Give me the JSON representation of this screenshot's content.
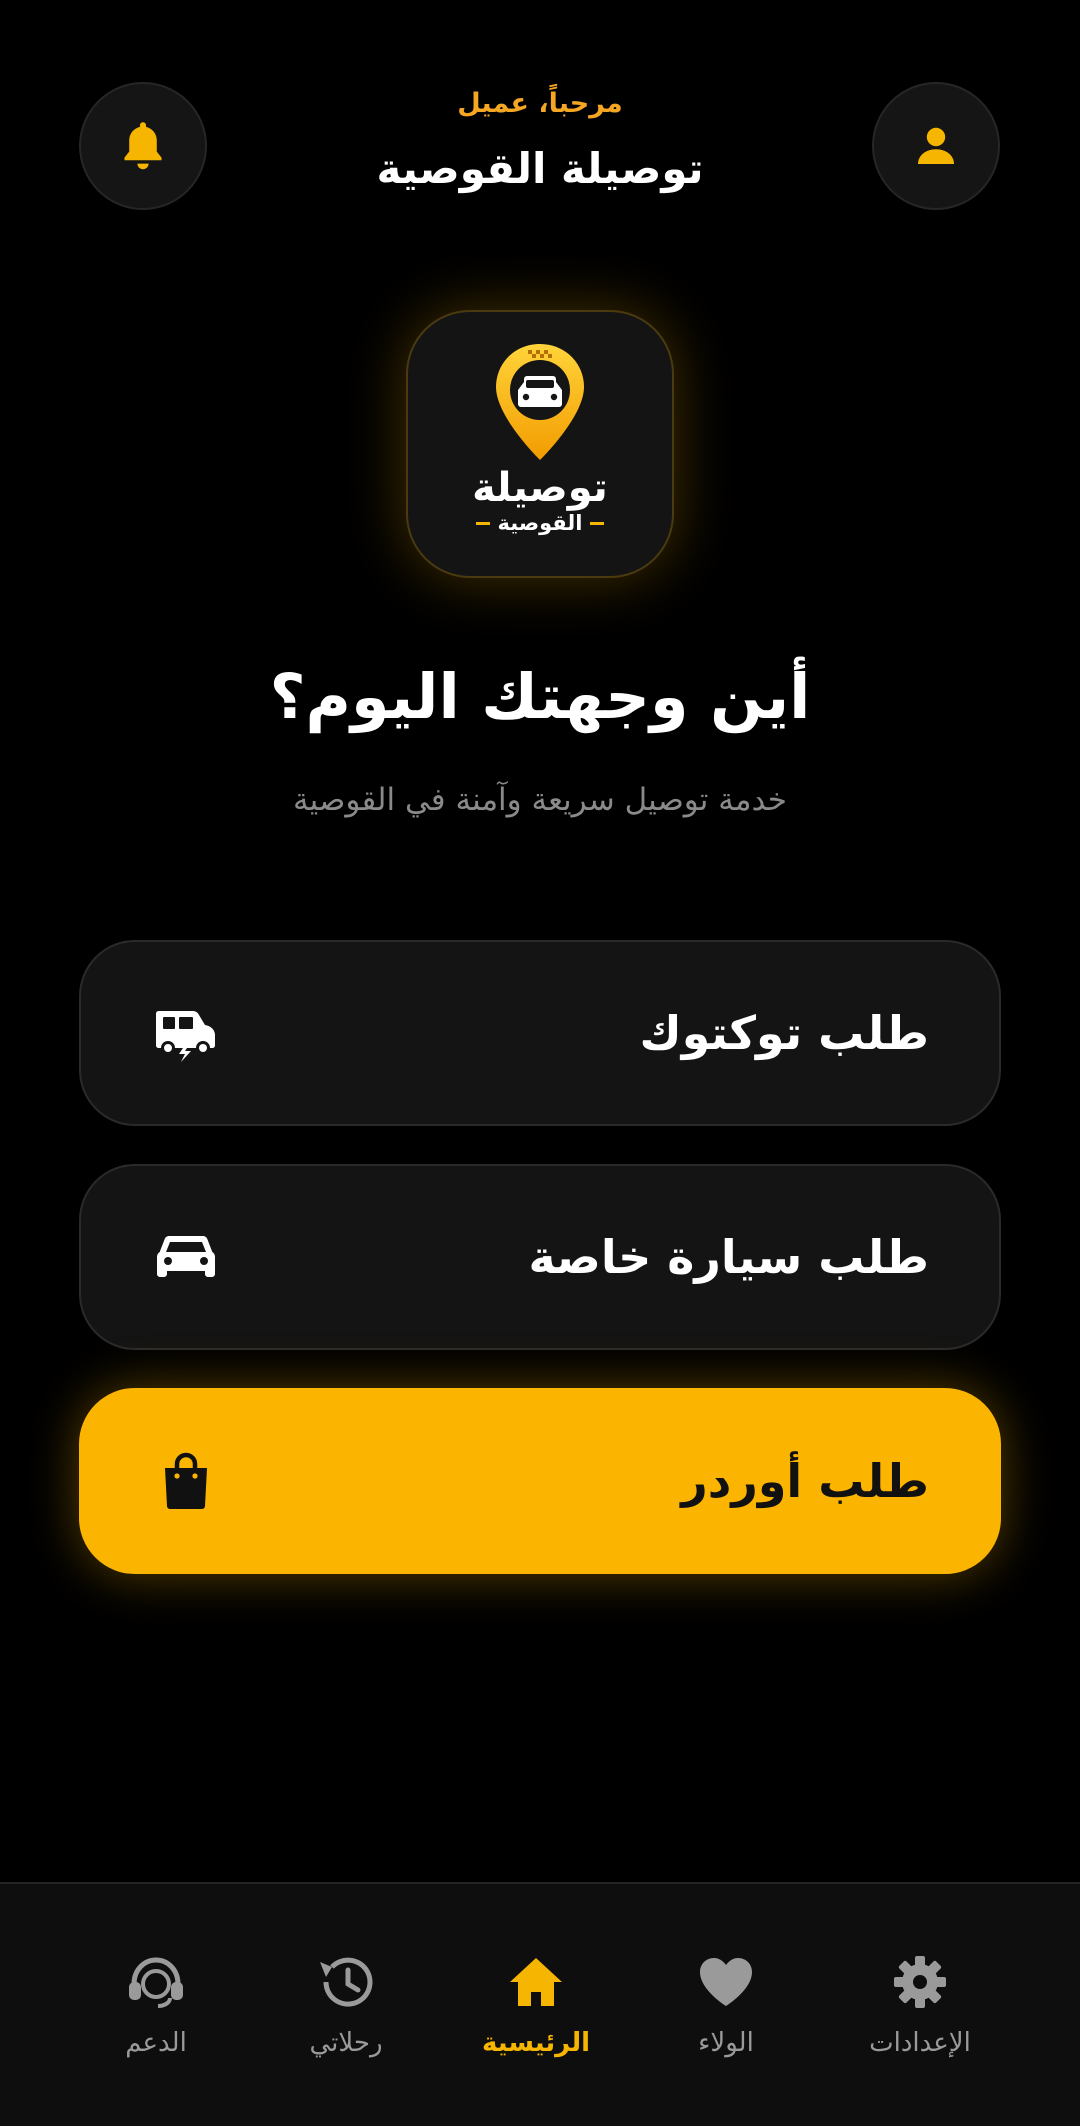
{
  "header": {
    "greeting": "مرحباً، عميل",
    "title": "توصيلة القوصية",
    "left_icon": "bell-icon",
    "right_icon": "user-icon"
  },
  "logo": {
    "icon": "taxi-location-pin-icon",
    "text_main": "توصيلة",
    "text_sub": "القوصية"
  },
  "hero": {
    "question": "أين وجهتك اليوم؟",
    "subtitle": "خدمة توصيل سريعة وآمنة في القوصية"
  },
  "options": [
    {
      "label": "طلب توكتوك",
      "icon": "tuktuk-icon"
    },
    {
      "label": "طلب سيارة خاصة",
      "icon": "car-icon"
    },
    {
      "label": "طلب أوردر",
      "icon": "shopping-bag-icon"
    }
  ],
  "nav": {
    "items": [
      {
        "label": "الدعم",
        "icon": "support-headset-icon"
      },
      {
        "label": "رحلاتي",
        "icon": "history-icon"
      },
      {
        "label": "الرئيسية",
        "icon": "home-icon",
        "active": true
      },
      {
        "label": "الولاء",
        "icon": "heart-icon"
      },
      {
        "label": "الإعدادات",
        "icon": "gear-icon"
      }
    ]
  },
  "colors": {
    "accent": "#fbb400",
    "background": "#000000",
    "card": "#141414",
    "muted_text": "#8a8a8a"
  }
}
